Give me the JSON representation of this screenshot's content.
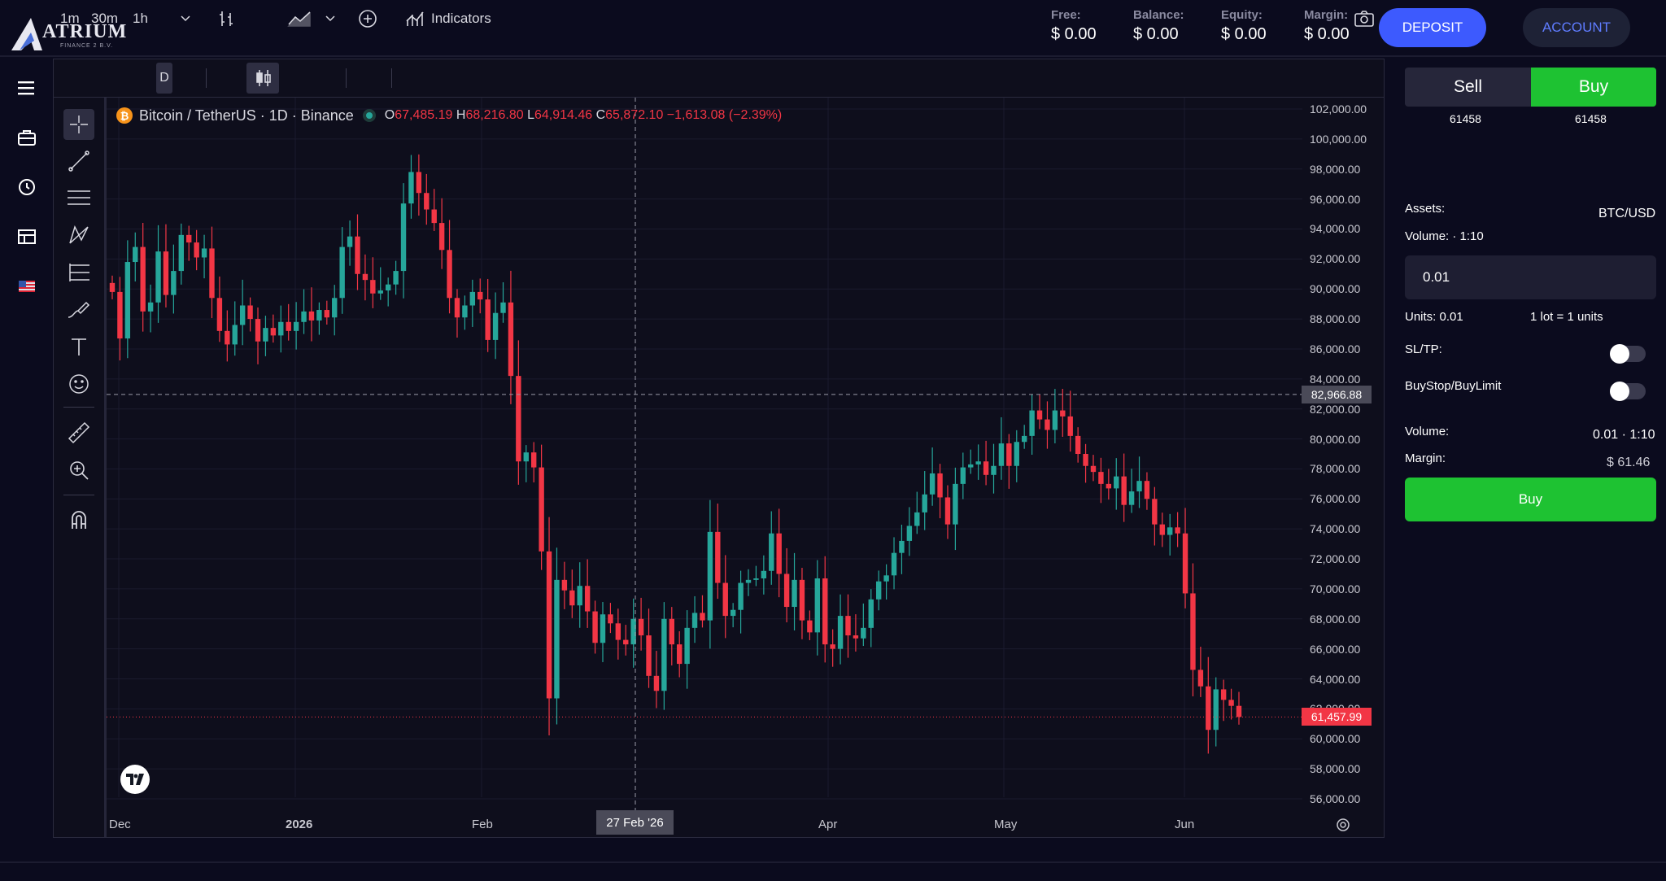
{
  "brand": {
    "name": "ATRIUM",
    "sub": "FINANCE 2 B.V."
  },
  "account_stats": [
    {
      "label": "Free:",
      "value": "$ 0.00"
    },
    {
      "label": "Balance:",
      "value": "$ 0.00"
    },
    {
      "label": "Equity:",
      "value": "$ 0.00"
    },
    {
      "label": "Margin:",
      "value": "$ 0.00"
    }
  ],
  "header": {
    "deposit_label": "DEPOSIT",
    "account_label": "ACCOUNT"
  },
  "left_nav": [
    "menu-icon",
    "briefcase-icon",
    "clock-icon",
    "table-icon",
    "us-flag-icon"
  ],
  "toolbar": {
    "intervals": [
      "1m",
      "30m",
      "1h",
      "D"
    ],
    "indicators_label": "Indicators"
  },
  "drawing_tools": [
    "crosshair-icon",
    "trendline-icon",
    "horizontal-lines-icon",
    "pattern-icon",
    "fib-icon",
    "brush-icon",
    "text-icon",
    "emoji-icon",
    "ruler-icon",
    "zoom-icon",
    "magnet-icon"
  ],
  "chart_data": {
    "type": "candlestick",
    "title": "Bitcoin / TetherUS · 1D · Binance",
    "ohlc_readout": {
      "open": "67,485.19",
      "high": "68,216.80",
      "low": "64,914.46",
      "close": "65,872.10",
      "change": "−1,613.08 (−2.39%)"
    },
    "y_ticks": [
      "102,000.00",
      "100,000.00",
      "98,000.00",
      "96,000.00",
      "94,000.00",
      "92,000.00",
      "90,000.00",
      "88,000.00",
      "86,000.00",
      "84,000.00",
      "82,000.00",
      "80,000.00",
      "78,000.00",
      "76,000.00",
      "74,000.00",
      "72,000.00",
      "70,000.00",
      "68,000.00",
      "66,000.00",
      "64,000.00",
      "62,000.00",
      "60,000.00",
      "58,000.00",
      "56,000.00"
    ],
    "ylim": [
      56000,
      102000
    ],
    "x_ticks": [
      "Dec",
      "2026",
      "Feb",
      "Apr",
      "May",
      "Jun"
    ],
    "crosshair_price": "82,966.88",
    "crosshair_date": "27 Feb '26",
    "last_price": "61,457.99",
    "colors": {
      "up": "#26a69a",
      "down": "#f23645"
    },
    "closes": [
      89800,
      86700,
      91800,
      92800,
      88500,
      89100,
      92500,
      89600,
      91200,
      93600,
      93100,
      92100,
      92700,
      89400,
      87200,
      86300,
      87600,
      88900,
      88000,
      86500,
      87400,
      86900,
      87800,
      87200,
      87800,
      88500,
      87900,
      88600,
      88100,
      89400,
      92800,
      93500,
      91000,
      90600,
      89700,
      89900,
      90300,
      91200,
      95700,
      97800,
      96400,
      95300,
      94400,
      92600,
      89400,
      88100,
      88900,
      89800,
      89300,
      86600,
      88400,
      89100,
      84200,
      78500,
      79100,
      78100,
      72500,
      62700,
      70600,
      69900,
      68900,
      70200,
      68500,
      66400,
      68300,
      67700,
      66600,
      66300,
      68000,
      66900,
      64200,
      63200,
      68000,
      66300,
      65000,
      67400,
      68400,
      67900,
      73800,
      70400,
      68200,
      68600,
      70400,
      70600,
      70700,
      71200,
      73700,
      71000,
      68800,
      70600,
      67900,
      67100,
      70700,
      66300,
      66000,
      68200,
      66900,
      66700,
      67400,
      69300,
      70500,
      70900,
      72400,
      73200,
      74200,
      75100,
      76300,
      77700,
      76100,
      74300,
      77000,
      78100,
      78300,
      78500,
      77600,
      78200,
      79700,
      78200,
      79800,
      80200,
      81900,
      81300,
      80600,
      81900,
      81500,
      80200,
      79000,
      78200,
      77800,
      77000,
      76700,
      77500,
      75600,
      76500,
      77200,
      76000,
      74300,
      73600,
      74100,
      73700,
      69700,
      64600,
      63500,
      60600,
      63300,
      62600,
      62200,
      61458
    ],
    "instrument": "BTC/USD"
  },
  "panel": {
    "sell_label": "Sell",
    "buy_tab_label": "Buy",
    "sell_price": "61458",
    "buy_price": "61458",
    "assets_label": "Assets:",
    "assets_value": "BTC/USD",
    "volume_leverage_label": "Volume: · 1:10",
    "volume_input": "0.01",
    "units_label": "Units: 0.01",
    "lot_label": "1 lot = 1 units",
    "sltp_label": "SL/TP:",
    "buystop_label": "BuyStop/BuyLimit",
    "volume_label": "Volume:",
    "volume_value": "0.01 · 1:10",
    "margin_label": "Margin:",
    "margin_value": "$ 61.46",
    "buy_button_label": "Buy"
  }
}
